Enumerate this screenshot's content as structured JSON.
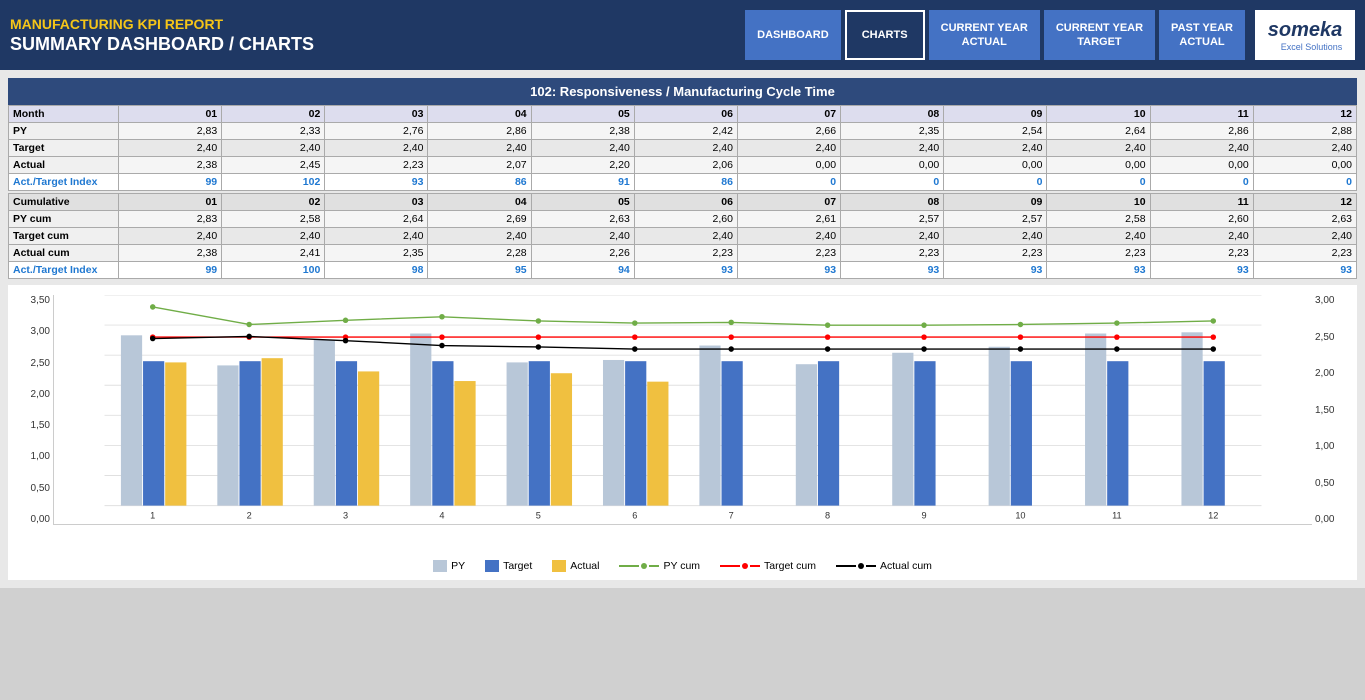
{
  "header": {
    "mfg_title": "MANUFACTURING KPI REPORT",
    "sub_title": "SUMMARY DASHBOARD / CHARTS",
    "logo_text": "someka",
    "logo_sub": "Excel Solutions"
  },
  "nav": {
    "buttons": [
      {
        "label": "DASHBOARD",
        "active": false
      },
      {
        "label": "CHARTS",
        "active": true
      },
      {
        "label": "CURRENT YEAR\nACTUAL",
        "active": false
      },
      {
        "label": "CURRENT YEAR\nTARGET",
        "active": false
      },
      {
        "label": "PAST YEAR\nACTUAL",
        "active": false
      }
    ]
  },
  "chart_title": "102: Responsiveness / Manufacturing Cycle Time",
  "monthly_table": {
    "headers": [
      "Month",
      "01",
      "02",
      "03",
      "04",
      "05",
      "06",
      "07",
      "08",
      "09",
      "10",
      "11",
      "12"
    ],
    "rows": [
      {
        "label": "PY",
        "values": [
          "2,83",
          "2,33",
          "2,76",
          "2,86",
          "2,38",
          "2,42",
          "2,66",
          "2,35",
          "2,54",
          "2,64",
          "2,86",
          "2,88"
        ]
      },
      {
        "label": "Target",
        "values": [
          "2,40",
          "2,40",
          "2,40",
          "2,40",
          "2,40",
          "2,40",
          "2,40",
          "2,40",
          "2,40",
          "2,40",
          "2,40",
          "2,40"
        ]
      },
      {
        "label": "Actual",
        "values": [
          "2,38",
          "2,45",
          "2,23",
          "2,07",
          "2,20",
          "2,06",
          "0,00",
          "0,00",
          "0,00",
          "0,00",
          "0,00",
          "0,00"
        ]
      },
      {
        "label": "Act./Target Index",
        "values": [
          "99",
          "102",
          "93",
          "86",
          "91",
          "86",
          "0",
          "0",
          "0",
          "0",
          "0",
          "0"
        ],
        "is_index": true
      }
    ]
  },
  "cumulative_table": {
    "headers": [
      "Cumulative",
      "01",
      "02",
      "03",
      "04",
      "05",
      "06",
      "07",
      "08",
      "09",
      "10",
      "11",
      "12"
    ],
    "rows": [
      {
        "label": "PY cum",
        "values": [
          "2,83",
          "2,58",
          "2,64",
          "2,69",
          "2,63",
          "2,60",
          "2,61",
          "2,57",
          "2,57",
          "2,58",
          "2,60",
          "2,63"
        ]
      },
      {
        "label": "Target cum",
        "values": [
          "2,40",
          "2,40",
          "2,40",
          "2,40",
          "2,40",
          "2,40",
          "2,40",
          "2,40",
          "2,40",
          "2,40",
          "2,40",
          "2,40"
        ]
      },
      {
        "label": "Actual cum",
        "values": [
          "2,38",
          "2,41",
          "2,35",
          "2,28",
          "2,26",
          "2,23",
          "2,23",
          "2,23",
          "2,23",
          "2,23",
          "2,23",
          "2,23"
        ]
      },
      {
        "label": "Act./Target Index",
        "values": [
          "99",
          "100",
          "98",
          "95",
          "94",
          "93",
          "93",
          "93",
          "93",
          "93",
          "93",
          "93"
        ],
        "is_index": true
      }
    ]
  },
  "y_axis_left": [
    "3,50",
    "3,00",
    "2,50",
    "2,00",
    "1,50",
    "1,00",
    "0,50",
    "0,00"
  ],
  "y_axis_right": [
    "3,00",
    "2,50",
    "2,00",
    "1,50",
    "1,00",
    "0,50",
    "0,00"
  ],
  "x_labels": [
    "1",
    "2",
    "3",
    "4",
    "5",
    "6",
    "7",
    "8",
    "9",
    "10",
    "11",
    "12"
  ],
  "legend": [
    {
      "label": "PY",
      "type": "box",
      "color": "#b8c7d8"
    },
    {
      "label": "Target",
      "type": "box",
      "color": "#4472c4"
    },
    {
      "label": "Actual",
      "type": "box",
      "color": "#f0c040"
    },
    {
      "label": "PY cum",
      "type": "line",
      "color": "#70ad47"
    },
    {
      "label": "Target cum",
      "type": "line",
      "color": "#ff0000"
    },
    {
      "label": "Actual cum",
      "type": "line",
      "color": "#000000"
    }
  ],
  "chart_data": {
    "py": [
      2.83,
      2.33,
      2.76,
      2.86,
      2.38,
      2.42,
      2.66,
      2.35,
      2.54,
      2.64,
      2.86,
      2.88
    ],
    "target": [
      2.4,
      2.4,
      2.4,
      2.4,
      2.4,
      2.4,
      2.4,
      2.4,
      2.4,
      2.4,
      2.4,
      2.4
    ],
    "actual": [
      2.38,
      2.45,
      2.23,
      2.07,
      2.2,
      2.06,
      0,
      0,
      0,
      0,
      0,
      0
    ],
    "py_cum": [
      2.83,
      2.58,
      2.64,
      2.69,
      2.63,
      2.6,
      2.61,
      2.57,
      2.57,
      2.58,
      2.6,
      2.63
    ],
    "target_cum": [
      2.4,
      2.4,
      2.4,
      2.4,
      2.4,
      2.4,
      2.4,
      2.4,
      2.4,
      2.4,
      2.4,
      2.4
    ],
    "actual_cum": [
      2.38,
      2.41,
      2.35,
      2.28,
      2.26,
      2.23,
      2.23,
      2.23,
      2.23,
      2.23,
      2.23,
      2.23
    ],
    "y_min": 0,
    "y_max": 3.5
  }
}
